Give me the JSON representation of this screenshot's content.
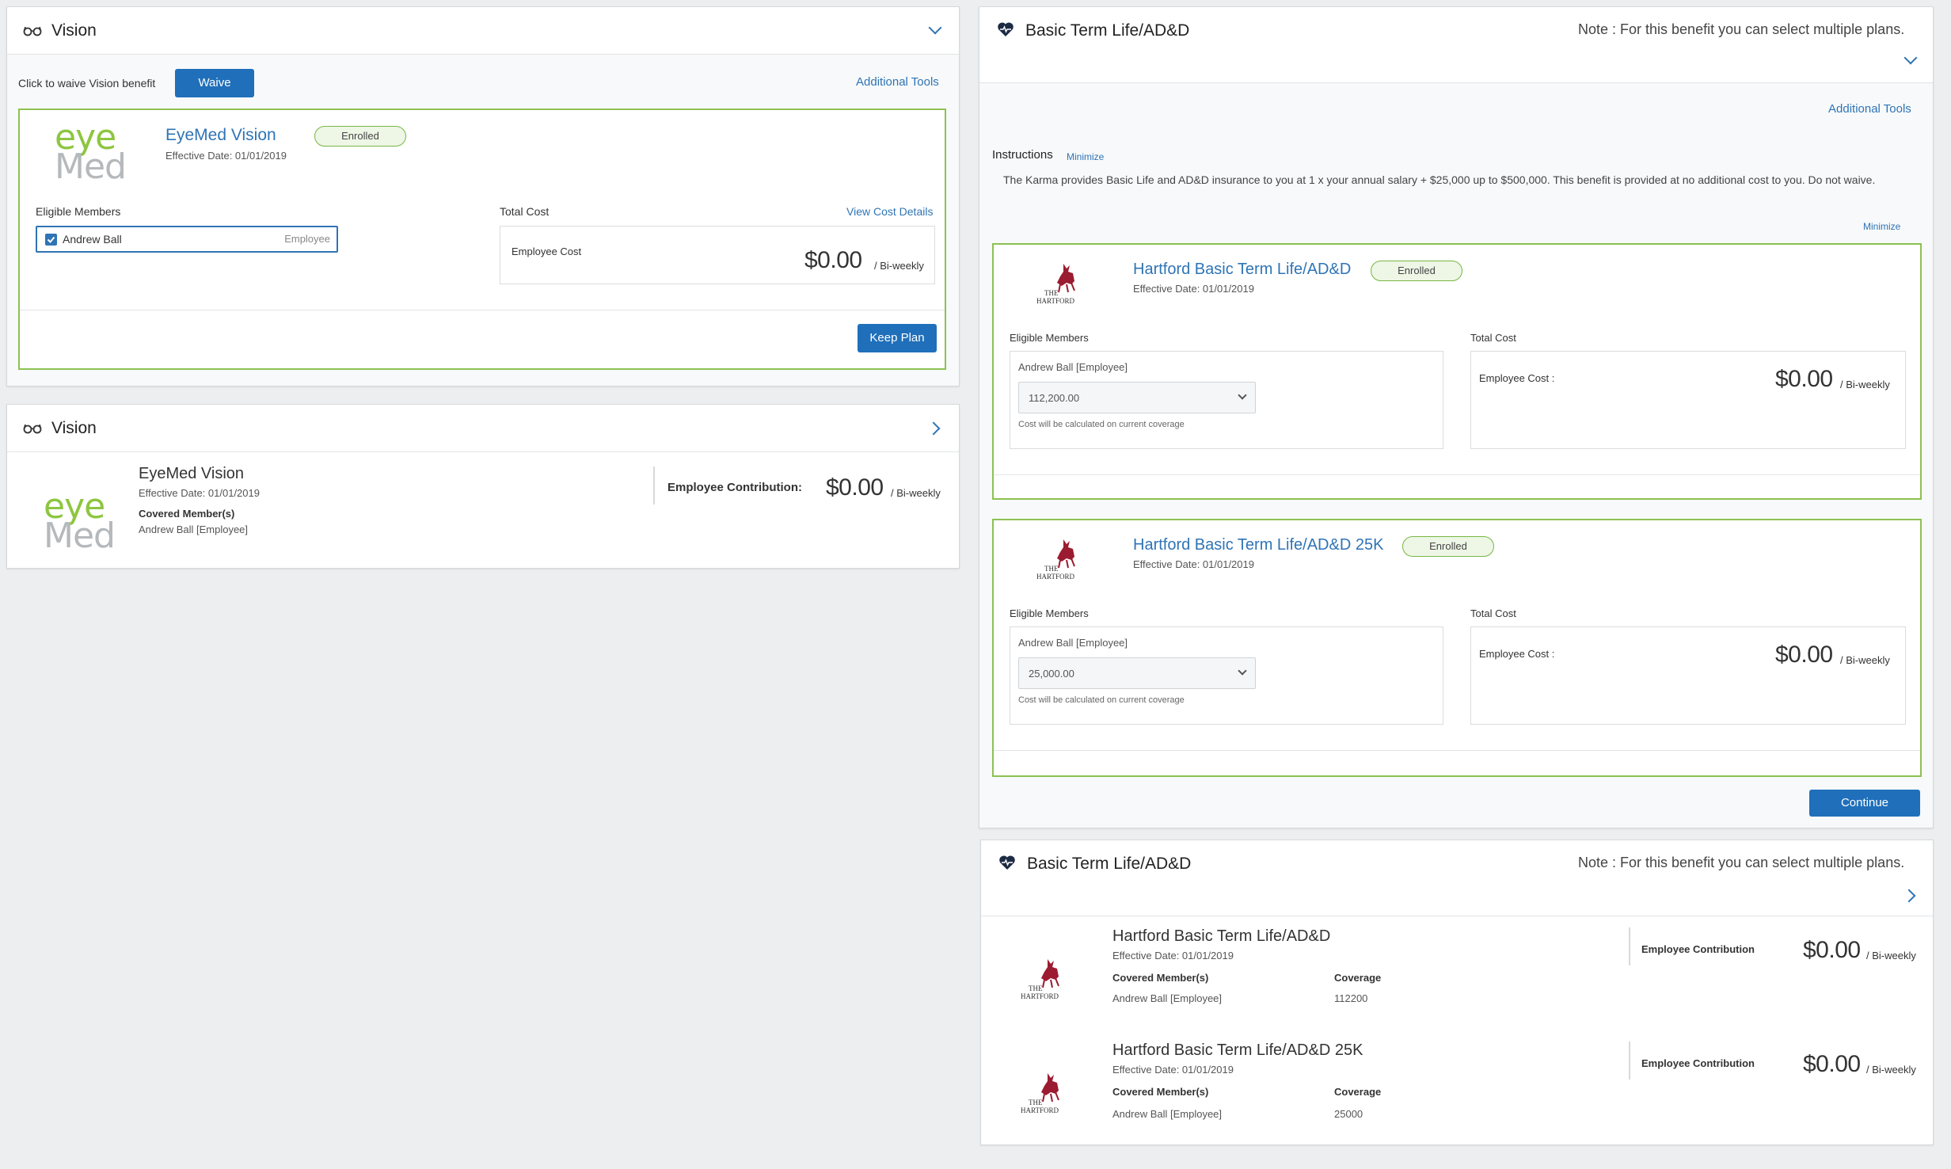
{
  "vision_edit": {
    "title": "Vision",
    "waive_prompt": "Click to waive Vision benefit",
    "waive_label": "Waive",
    "additional_tools": "Additional Tools",
    "plan": {
      "name": "EyeMed Vision",
      "status": "Enrolled",
      "effective": "Effective Date: 01/01/2019",
      "eligible_label": "Eligible Members",
      "member_name": "Andrew Ball",
      "member_role": "Employee",
      "total_cost_label": "Total Cost",
      "view_cost": "View Cost Details",
      "employee_cost_label": "Employee Cost",
      "price": "$0.00",
      "period": "/ Bi-weekly",
      "keep_label": "Keep Plan"
    },
    "logo_top": "eye",
    "logo_bottom": "Med"
  },
  "vision_summary": {
    "title": "Vision",
    "plan_name": "EyeMed Vision",
    "effective": "Effective Date: 01/01/2019",
    "covered_label": "Covered Member(s)",
    "covered_value": "Andrew Ball [Employee]",
    "contribution_label": "Employee Contribution:",
    "price": "$0.00",
    "period": "/ Bi-weekly"
  },
  "life_edit": {
    "title": "Basic Term Life/AD&D",
    "note": "Note : For this benefit you can select multiple plans.",
    "additional_tools": "Additional Tools",
    "instructions_label": "Instructions",
    "minimize": "Minimize",
    "instructions_text": "The Karma provides Basic Life and AD&D insurance to you at 1 x your annual salary + $25,000 up to $500,000.  This benefit is provided at no additional cost to you. Do not waive.",
    "minimize_bottom": "Minimize",
    "plans": [
      {
        "name": "Hartford Basic Term Life/AD&D",
        "status": "Enrolled",
        "effective": "Effective Date: 01/01/2019",
        "eligible_label": "Eligible Members",
        "member": "Andrew Ball [Employee]",
        "coverage": "112,200.00",
        "note": "Cost will be calculated on current coverage",
        "total_cost_label": "Total Cost",
        "employee_cost_label": "Employee Cost :",
        "price": "$0.00",
        "period": "/ Bi-weekly"
      },
      {
        "name": "Hartford Basic Term Life/AD&D 25K",
        "status": "Enrolled",
        "effective": "Effective Date: 01/01/2019",
        "eligible_label": "Eligible Members",
        "member": "Andrew Ball [Employee]",
        "coverage": "25,000.00",
        "note": "Cost will be calculated on current coverage",
        "total_cost_label": "Total Cost",
        "employee_cost_label": "Employee Cost :",
        "price": "$0.00",
        "period": "/ Bi-weekly"
      }
    ],
    "continue_label": "Continue"
  },
  "life_summary": {
    "title": "Basic Term Life/AD&D",
    "note": "Note : For this benefit you can select multiple plans.",
    "plans": [
      {
        "name": "Hartford Basic Term Life/AD&D",
        "effective": "Effective Date: 01/01/2019",
        "covered_label": "Covered Member(s)",
        "covered_value": "Andrew Ball [Employee]",
        "coverage_label": "Coverage",
        "coverage_value": "112200",
        "contribution_label": "Employee Contribution",
        "price": "$0.00",
        "period": "/ Bi-weekly"
      },
      {
        "name": "Hartford Basic Term Life/AD&D 25K",
        "effective": "Effective Date: 01/01/2019",
        "covered_label": "Covered Member(s)",
        "covered_value": "Andrew Ball [Employee]",
        "coverage_label": "Coverage",
        "coverage_value": "25000",
        "contribution_label": "Employee Contribution",
        "price": "$0.00",
        "period": "/ Bi-weekly"
      }
    ]
  },
  "hartford_logo": {
    "line1": "THE",
    "line2": "HARTFORD"
  },
  "colors": {
    "accent": "#1f6fba",
    "enrolled_border": "#8cc152",
    "eyemed_green": "#8dc63f",
    "hartford_red": "#9b1b30"
  }
}
